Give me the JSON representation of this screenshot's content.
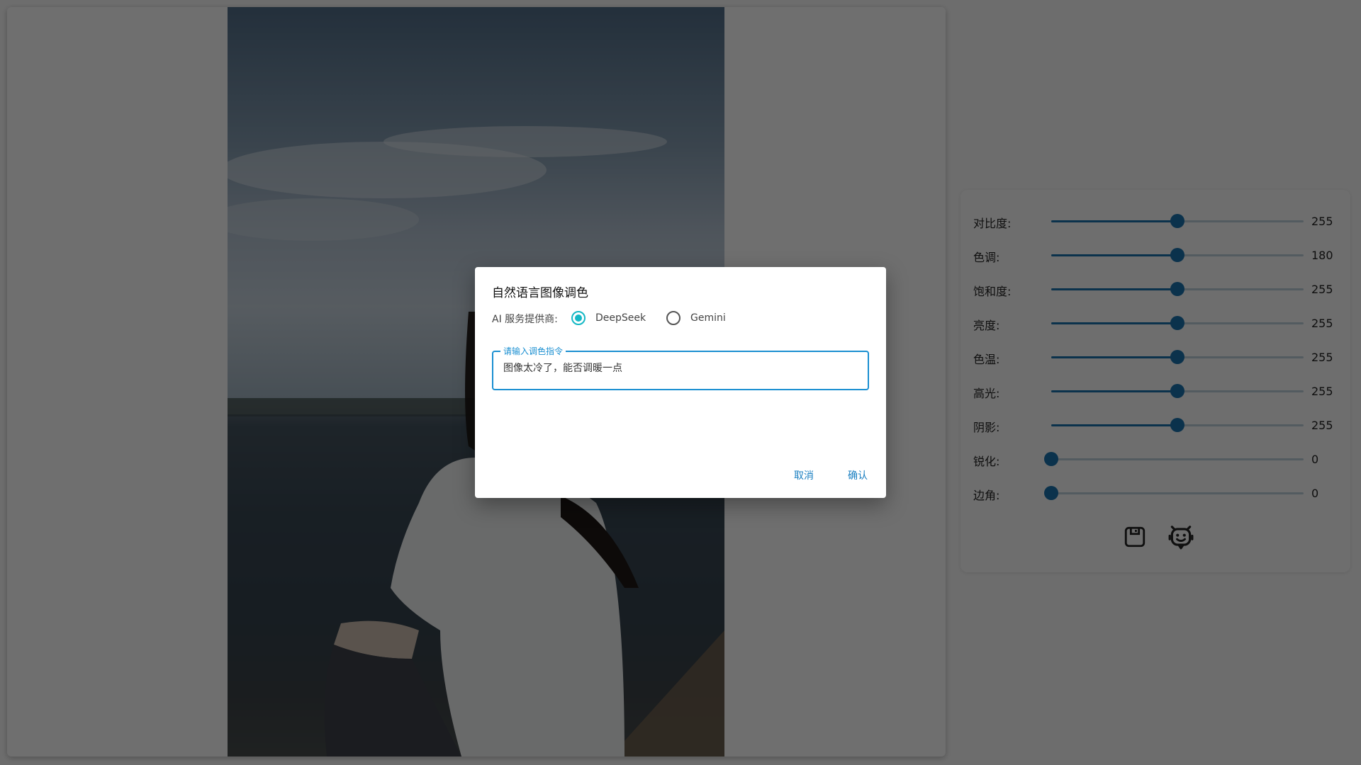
{
  "sliders": [
    {
      "label": "对比度:",
      "value": "255",
      "fraction": 0.5
    },
    {
      "label": "色调:",
      "value": "180",
      "fraction": 0.5
    },
    {
      "label": "饱和度:",
      "value": "255",
      "fraction": 0.5
    },
    {
      "label": "亮度:",
      "value": "255",
      "fraction": 0.5
    },
    {
      "label": "色温:",
      "value": "255",
      "fraction": 0.5
    },
    {
      "label": "高光:",
      "value": "255",
      "fraction": 0.5
    },
    {
      "label": "阴影:",
      "value": "255",
      "fraction": 0.5
    },
    {
      "label": "锐化:",
      "value": "0",
      "fraction": 0.0
    },
    {
      "label": "边角:",
      "value": "0",
      "fraction": 0.0
    }
  ],
  "toolbar": {
    "save_icon": "save-icon",
    "ai_icon": "robot-icon"
  },
  "dialog": {
    "title": "自然语言图像调色",
    "provider_label": "AI 服务提供商:",
    "providers": [
      "DeepSeek",
      "Gemini"
    ],
    "selected_provider": "DeepSeek",
    "field_label": "请输入调色指令",
    "field_value": "图像太冷了，能否调暖一点",
    "cancel_label": "取消",
    "confirm_label": "确认"
  },
  "colors": {
    "accent": "#1a6fa8",
    "radio_selected": "#14b8c5",
    "link": "#1a7fc1"
  }
}
